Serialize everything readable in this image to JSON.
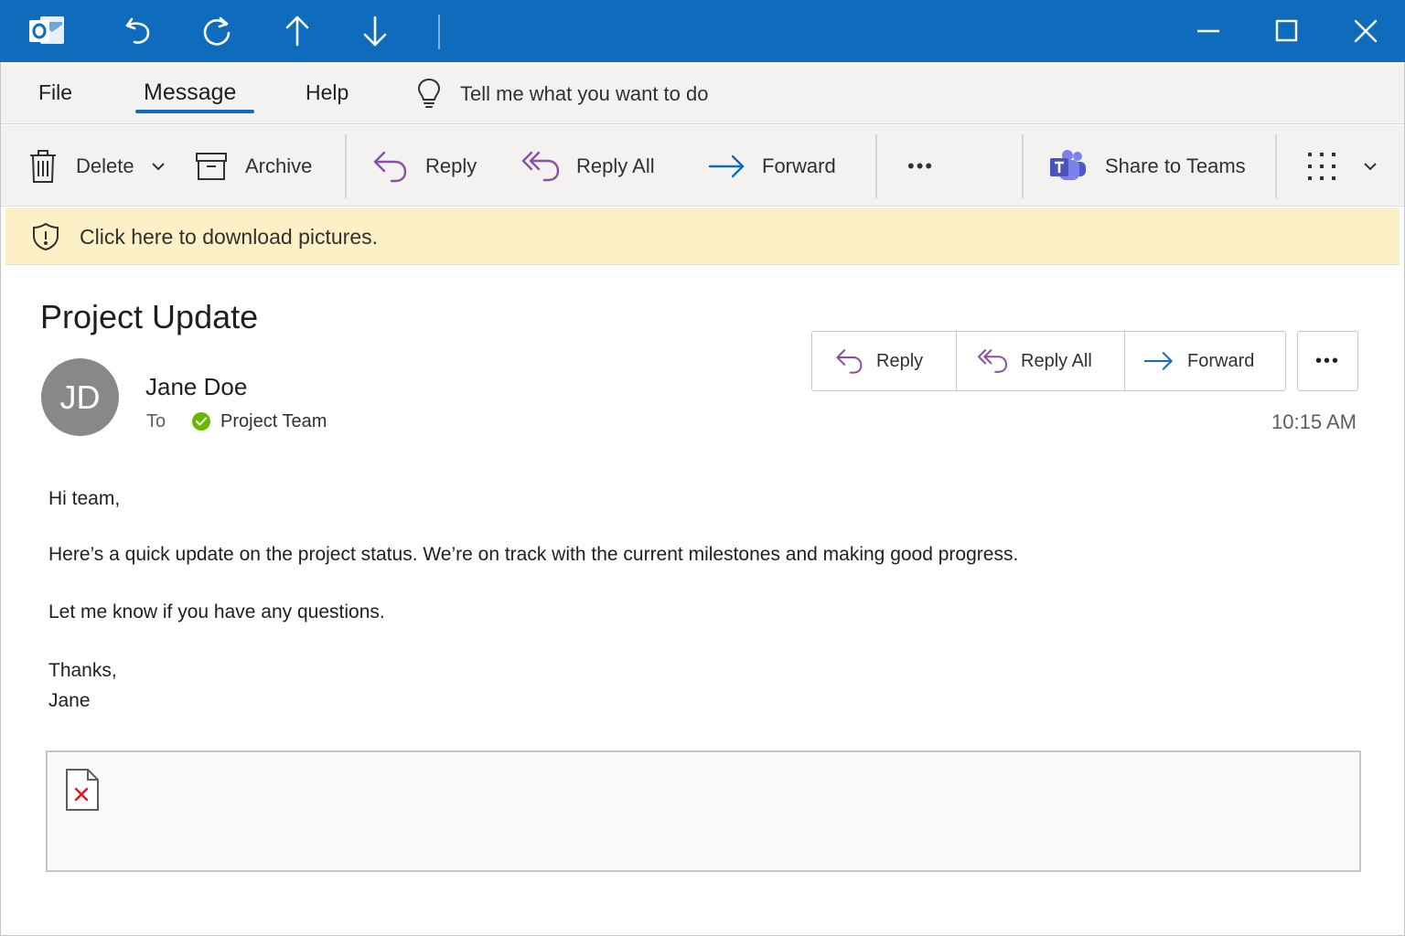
{
  "titlebar": {
    "app_icon": "outlook-icon",
    "quick_access": [
      "undo-icon",
      "redo-icon",
      "previous-item-icon",
      "next-item-icon"
    ],
    "window_controls": [
      "minimize-icon",
      "maximize-icon",
      "close-icon"
    ],
    "color": "#0f6cbd"
  },
  "menu": {
    "items": [
      {
        "label": "File"
      },
      {
        "label": "Message",
        "active": true
      },
      {
        "label": "Help"
      }
    ],
    "tell_me": "Tell me what you want to do"
  },
  "ribbon": {
    "delete": "Delete",
    "archive": "Archive",
    "reply": "Reply",
    "reply_all": "Reply All",
    "forward": "Forward",
    "more": "•••",
    "share_teams": "Share to Teams"
  },
  "infobar": {
    "text": "Click here to download pictures.",
    "color": "#fcf0c7"
  },
  "message": {
    "subject": "Project Update",
    "avatar_initials": "JD",
    "sender": "Jane Doe",
    "to_label": "To",
    "recipient": "Project Team",
    "time": "10:15 AM",
    "actions": {
      "reply": "Reply",
      "reply_all": "Reply All",
      "forward": "Forward",
      "more": "•••"
    },
    "body": {
      "greeting": "Hi team,",
      "line1": "Here’s a quick update on the project status. We’re on track with the current milestones and making good progress.",
      "line2": "Let me know if you have any questions.",
      "signoff": "Thanks,",
      "signature": "Jane"
    }
  },
  "colors": {
    "accent": "#0f6cbd",
    "reply_purple": "#8b4fa8",
    "forward_blue": "#0f6cbd",
    "presence_green": "#6bb700"
  }
}
